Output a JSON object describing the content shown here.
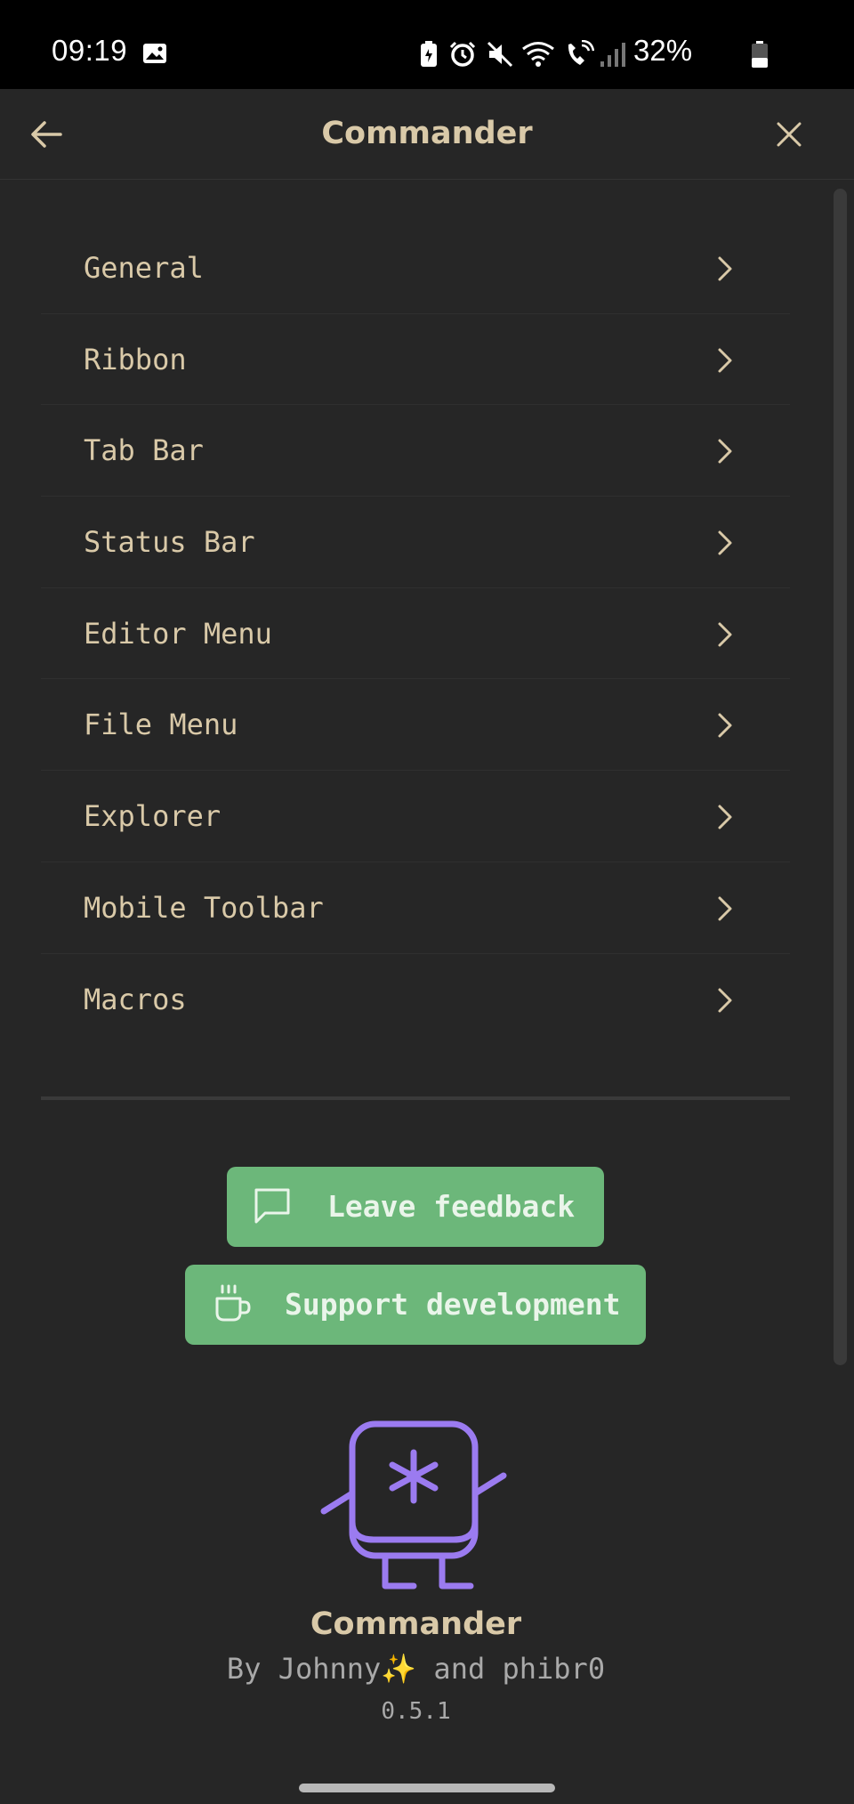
{
  "status_bar": {
    "time": "09:19",
    "battery": "32%"
  },
  "header": {
    "title": "Commander"
  },
  "menu": {
    "items": [
      {
        "label": "General"
      },
      {
        "label": "Ribbon"
      },
      {
        "label": "Tab Bar"
      },
      {
        "label": "Status Bar"
      },
      {
        "label": "Editor Menu"
      },
      {
        "label": "File Menu"
      },
      {
        "label": "Explorer"
      },
      {
        "label": "Mobile Toolbar"
      },
      {
        "label": "Macros"
      }
    ]
  },
  "buttons": {
    "feedback_label": "Leave feedback",
    "support_label": "Support development"
  },
  "footer": {
    "name": "Commander",
    "authors": "By Johnny✨ and phibr0",
    "version": "0.5.1"
  },
  "colors": {
    "background": "#262626",
    "text": "#d9c9a8",
    "accent_green": "#6cb77a",
    "mascot_purple": "#9b7bf0"
  }
}
